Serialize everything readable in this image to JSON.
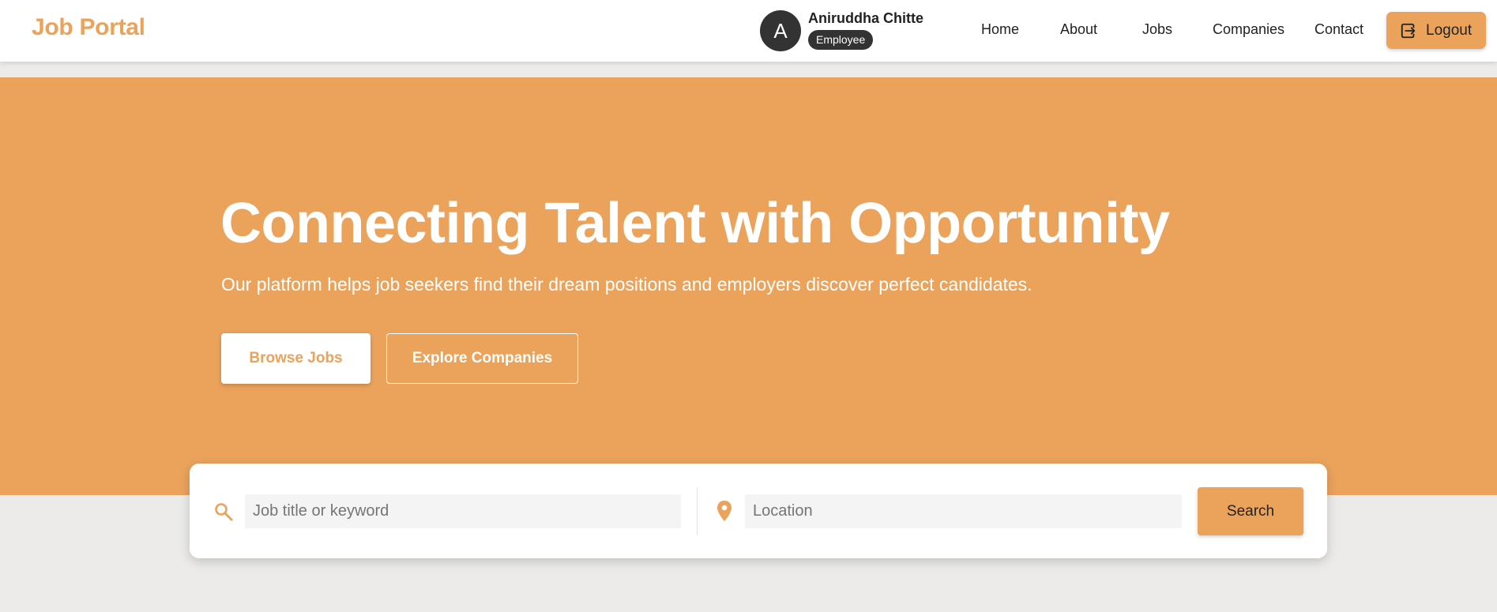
{
  "brand": {
    "name": "Job Portal"
  },
  "user": {
    "avatar_initial": "A",
    "name": "Aniruddha Chitte",
    "role": "Employee"
  },
  "nav": {
    "home": "Home",
    "about": "About",
    "jobs": "Jobs",
    "companies": "Companies",
    "contact": "Contact",
    "logout": "Logout"
  },
  "hero": {
    "title": "Connecting Talent with Opportunity",
    "subtitle": "Our platform helps job seekers find their dream positions and employers discover perfect candidates.",
    "browse_label": "Browse Jobs",
    "explore_label": "Explore Companies"
  },
  "search": {
    "keyword_placeholder": "Job title or keyword",
    "keyword_value": "",
    "location_placeholder": "Location",
    "location_value": "",
    "button_label": "Search"
  },
  "colors": {
    "accent": "#eba35c",
    "dark": "#333333",
    "page_bg": "#ecebe9",
    "white": "#ffffff"
  }
}
